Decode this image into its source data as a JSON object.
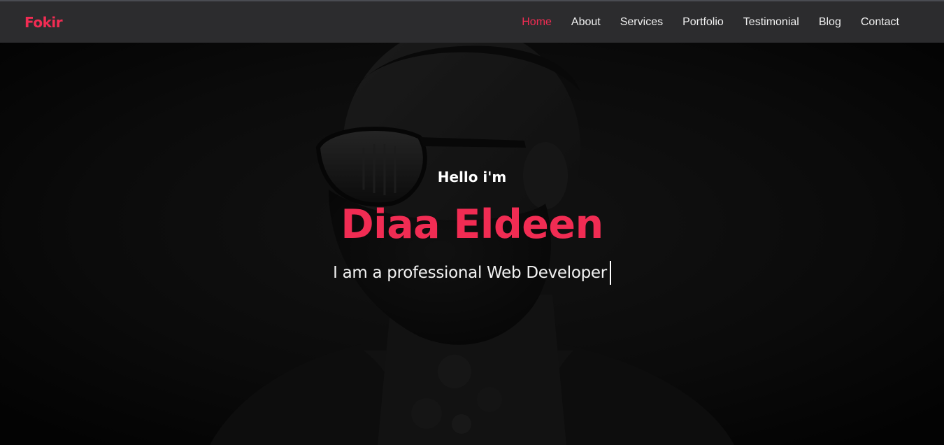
{
  "brand": {
    "logo": "Fokir",
    "accent_color": "#f12c53"
  },
  "nav": {
    "items": [
      {
        "label": "Home",
        "active": true
      },
      {
        "label": "About",
        "active": false
      },
      {
        "label": "Services",
        "active": false
      },
      {
        "label": "Portfolio",
        "active": false
      },
      {
        "label": "Testimonial",
        "active": false
      },
      {
        "label": "Blog",
        "active": false
      },
      {
        "label": "Contact",
        "active": false
      }
    ]
  },
  "hero": {
    "greeting": "Hello i'm",
    "name": "Diaa Eldeen",
    "tagline": "I am a professional Web Developer",
    "background_icon": "portrait-photo"
  }
}
